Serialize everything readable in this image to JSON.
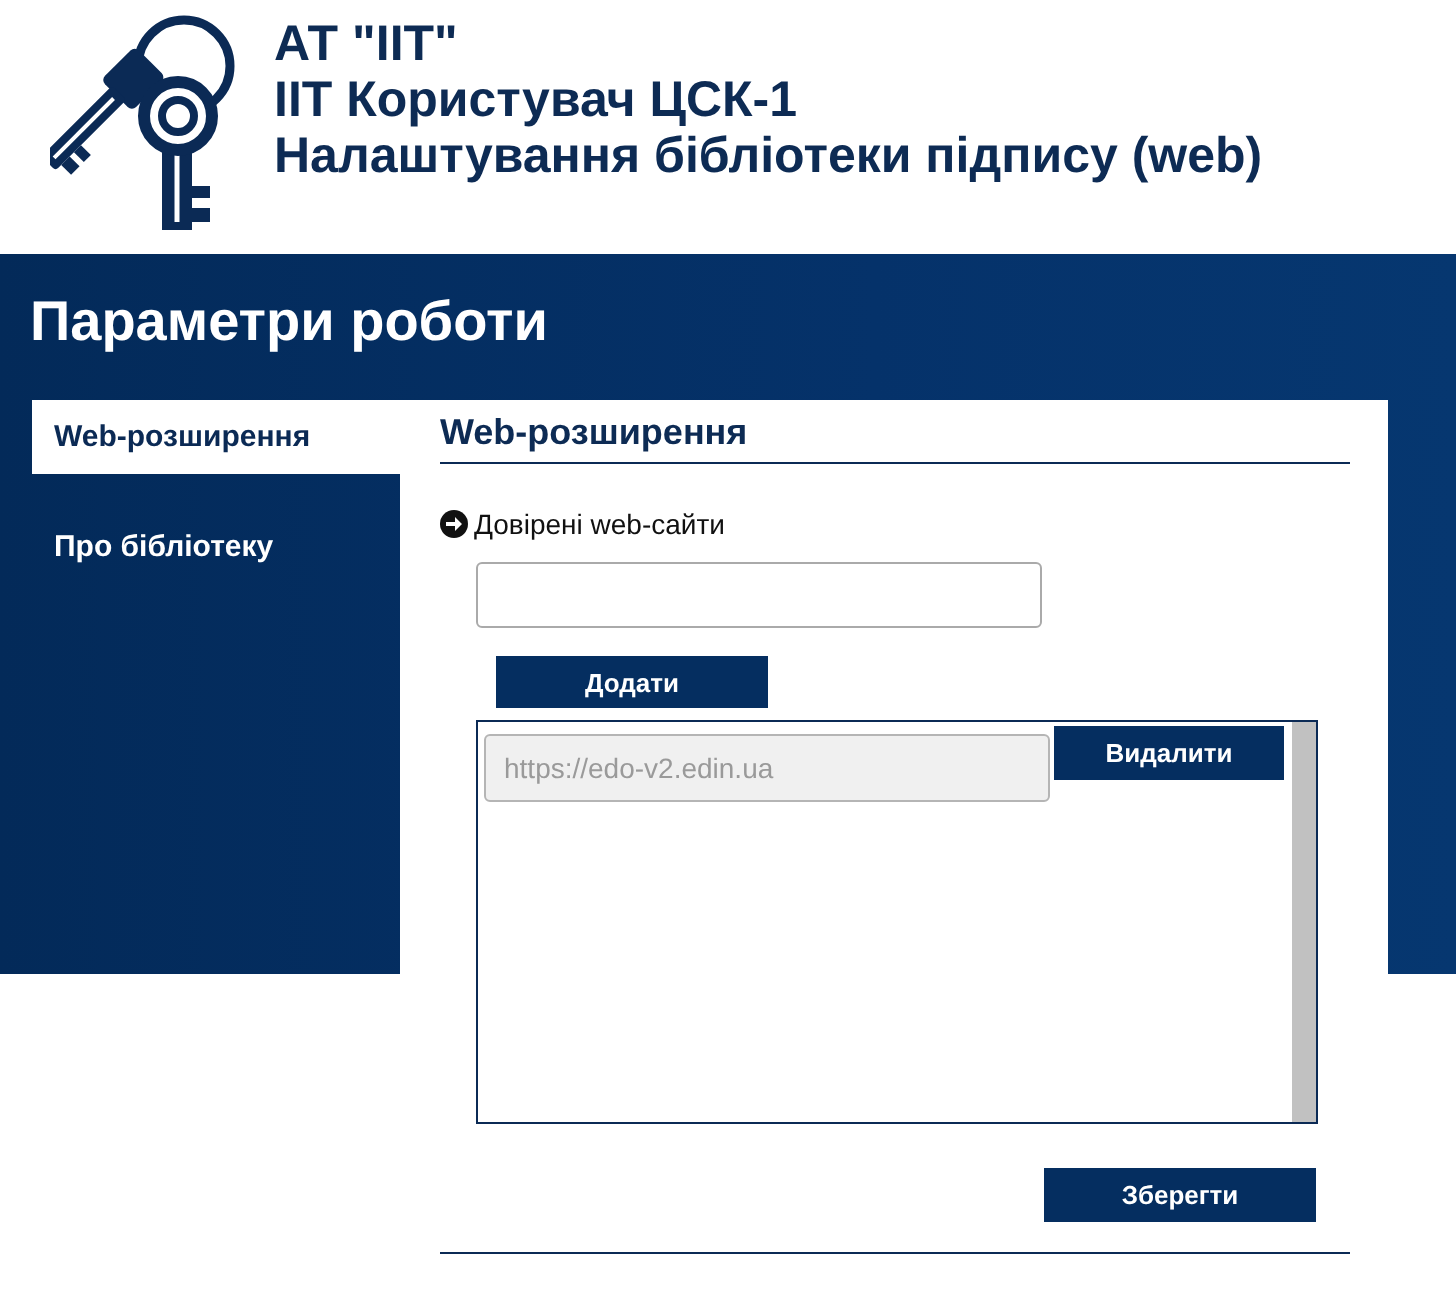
{
  "header": {
    "lines": [
      "АТ \"ІІТ\"",
      "ІІТ Користувач ЦСК-1",
      "Налаштування бібліотеки підпису (web)"
    ]
  },
  "page_title": "Параметри роботи",
  "sidebar": {
    "items": [
      {
        "label": "Web-розширення",
        "selected": true
      },
      {
        "label": "Про бібліотеку",
        "selected": false
      }
    ]
  },
  "panel": {
    "heading": "Web-розширення",
    "section_label": "Довірені web-сайти",
    "add_button": "Додати",
    "sites": [
      {
        "url": "https://edo-v2.edin.ua",
        "disabled": true,
        "remove_button": "Видалити"
      }
    ],
    "save_button": "Зберегти"
  }
}
